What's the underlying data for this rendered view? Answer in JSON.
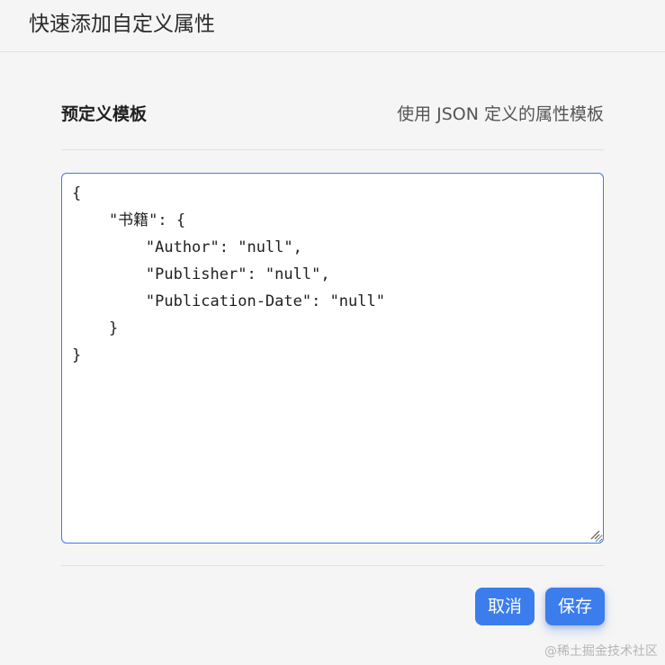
{
  "dialog": {
    "title": "快速添加自定义属性"
  },
  "section": {
    "title": "预定义模板",
    "description": "使用 JSON 定义的属性模板"
  },
  "editor": {
    "content": "{\n    \"书籍\": {\n        \"Author\": \"null\",\n        \"Publisher\": \"null\",\n        \"Publication-Date\": \"null\"\n    }\n}"
  },
  "buttons": {
    "cancel_label": "取消",
    "save_label": "保存"
  },
  "watermark": "@稀土掘金技术社区",
  "colors": {
    "accent": "#3b7ded",
    "background": "#f5f5f5",
    "editor_background": "#ffffff"
  }
}
